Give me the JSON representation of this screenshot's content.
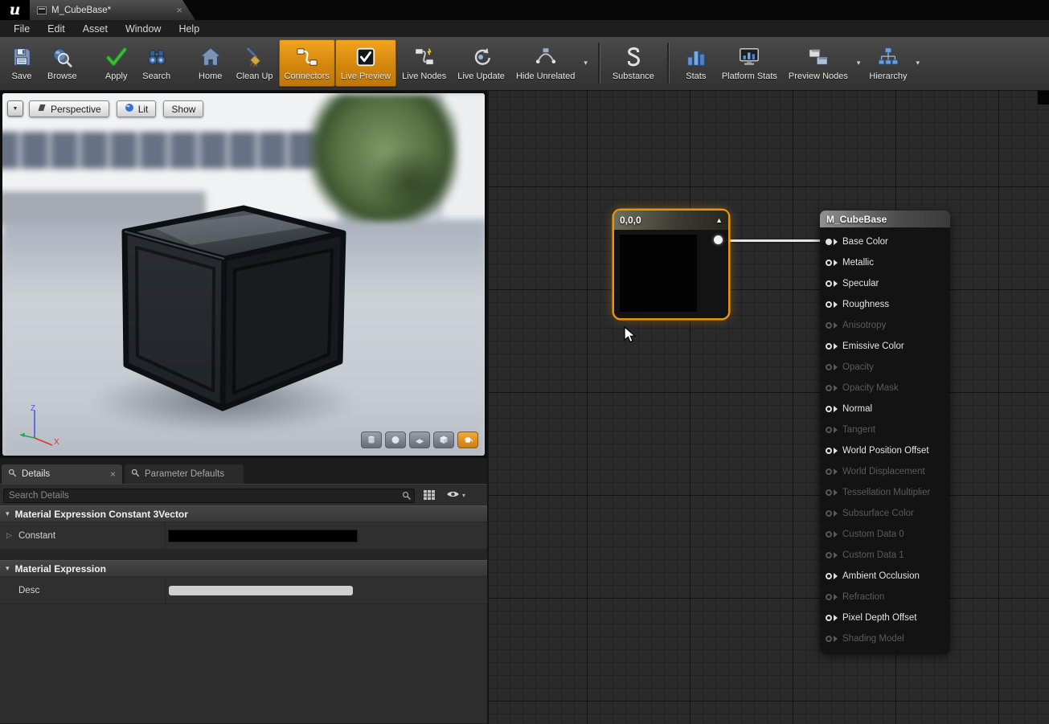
{
  "icons": {
    "close": "×",
    "chevron_down": "▾",
    "dropdown_arrow": "▼",
    "collapse_arrow": "▲",
    "row_expander": "▷",
    "section_arrow": "▾"
  },
  "titlebar": {
    "tab": {
      "title": "M_CubeBase*"
    }
  },
  "menubar": {
    "items": [
      "File",
      "Edit",
      "Asset",
      "Window",
      "Help"
    ]
  },
  "toolbar": {
    "buttons": [
      {
        "label": "Save",
        "icon": "save"
      },
      {
        "label": "Browse",
        "icon": "browse"
      },
      {
        "type": "gap"
      },
      {
        "label": "Apply",
        "icon": "apply"
      },
      {
        "label": "Search",
        "icon": "search"
      },
      {
        "type": "gap"
      },
      {
        "label": "Home",
        "icon": "home"
      },
      {
        "label": "Clean Up",
        "icon": "cleanup"
      },
      {
        "label": "Connectors",
        "icon": "connectors",
        "active": true
      },
      {
        "label": "Live Preview",
        "icon": "livepreview",
        "active": true
      },
      {
        "label": "Live Nodes",
        "icon": "livenodes"
      },
      {
        "label": "Live Update",
        "icon": "liveupdate"
      },
      {
        "label": "Hide Unrelated",
        "icon": "hideunrelated",
        "dropdown": true
      },
      {
        "type": "sep"
      },
      {
        "label": "Substance",
        "icon": "substance"
      },
      {
        "type": "sep"
      },
      {
        "label": "Stats",
        "icon": "stats"
      },
      {
        "label": "Platform Stats",
        "icon": "platformstats"
      },
      {
        "label": "Preview Nodes",
        "icon": "previewnodes",
        "dropdown": true
      },
      {
        "label": "Hierarchy",
        "icon": "hierarchy",
        "dropdown": true
      }
    ]
  },
  "viewport": {
    "mode_buttons": [
      {
        "label": "Perspective",
        "icon": "perspective"
      },
      {
        "label": "Lit",
        "icon": "lit"
      },
      {
        "label": "Show"
      }
    ],
    "axis_labels": {
      "x": "X",
      "z": "Z"
    },
    "shape_buttons": [
      "cylinder",
      "sphere",
      "plane",
      "cube",
      "mesh"
    ],
    "active_shape": "mesh"
  },
  "details": {
    "tabs": [
      {
        "label": "Details",
        "active": true,
        "closable": true
      },
      {
        "label": "Parameter Defaults",
        "active": false
      }
    ],
    "search": {
      "placeholder": "Search Details"
    },
    "sections": [
      {
        "title": "Material Expression Constant 3Vector",
        "rows": [
          {
            "label": "Constant",
            "expandable": true,
            "value_kind": "color",
            "value": "#000000"
          }
        ]
      },
      {
        "title": "Material Expression",
        "rows": [
          {
            "label": "Desc",
            "expandable": false,
            "value_kind": "text",
            "value": ""
          }
        ]
      }
    ]
  },
  "graph": {
    "constant_node": {
      "title": "0,0,0",
      "selected": true,
      "preview_color": "#030303"
    },
    "material_node": {
      "title": "M_CubeBase",
      "pins": [
        {
          "label": "Base Color",
          "state": "connected"
        },
        {
          "label": "Metallic",
          "state": "active"
        },
        {
          "label": "Specular",
          "state": "active"
        },
        {
          "label": "Roughness",
          "state": "active"
        },
        {
          "label": "Anisotropy",
          "state": "disabled"
        },
        {
          "label": "Emissive Color",
          "state": "active"
        },
        {
          "label": "Opacity",
          "state": "disabled"
        },
        {
          "label": "Opacity Mask",
          "state": "disabled"
        },
        {
          "label": "Normal",
          "state": "active"
        },
        {
          "label": "Tangent",
          "state": "disabled"
        },
        {
          "label": "World Position Offset",
          "state": "active"
        },
        {
          "label": "World Displacement",
          "state": "disabled"
        },
        {
          "label": "Tessellation Multiplier",
          "state": "disabled"
        },
        {
          "label": "Subsurface Color",
          "state": "disabled"
        },
        {
          "label": "Custom Data 0",
          "state": "disabled"
        },
        {
          "label": "Custom Data 1",
          "state": "disabled"
        },
        {
          "label": "Ambient Occlusion",
          "state": "active"
        },
        {
          "label": "Refraction",
          "state": "disabled"
        },
        {
          "label": "Pixel Depth Offset",
          "state": "active"
        },
        {
          "label": "Shading Model",
          "state": "disabled"
        }
      ]
    }
  },
  "colors": {
    "selection_orange": "#ea940e",
    "toolbar_active_orange": "#e89112",
    "wire": "#e4e4e4",
    "constant_swatch": "#000000",
    "desc_field": "#cfd0d1"
  }
}
